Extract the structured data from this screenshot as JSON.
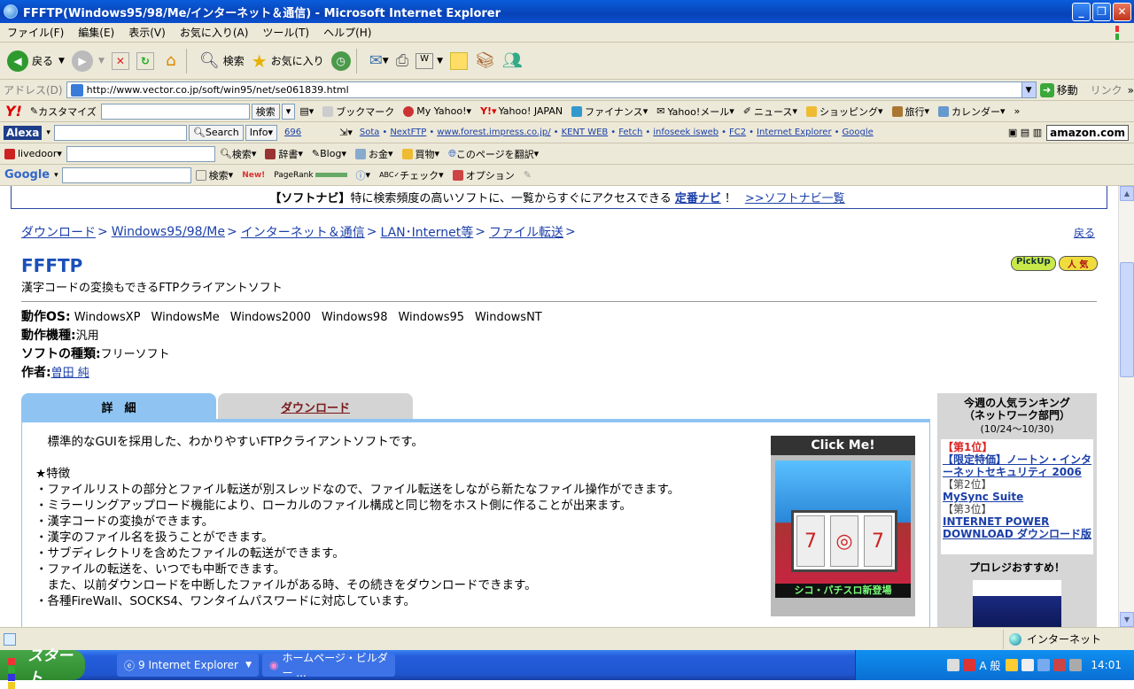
{
  "window": {
    "title": "FFFTP(Windows95/98/Me/インターネット＆通信) - Microsoft Internet Explorer"
  },
  "menu": [
    "ファイル(F)",
    "編集(E)",
    "表示(V)",
    "お気に入り(A)",
    "ツール(T)",
    "ヘルプ(H)"
  ],
  "toolbar": {
    "back": "戻る",
    "search": "検索",
    "favorites": "お気に入り"
  },
  "address": {
    "label": "アドレス(D)",
    "url": "http://www.vector.co.jp/soft/win95/net/se061839.html",
    "go": "移動",
    "links": "リンク"
  },
  "yahoo_bar": {
    "customize": "カスタマイズ",
    "search_btn": "検索",
    "items": [
      "ブックマーク",
      "My Yahoo!",
      "Yahoo! JAPAN",
      "ファイナンス",
      "Yahoo!メール",
      "ニュース",
      "ショッピング",
      "旅行",
      "カレンダー"
    ]
  },
  "alexa_bar": {
    "label": "Alexa",
    "search_btn": "Search",
    "info_btn": "Info",
    "count": "696",
    "links": [
      "Sota",
      "NextFTP",
      "www.forest.impress.co.jp/",
      "KENT WEB",
      "Fetch",
      "infoseek isweb",
      "FC2",
      "Internet Explorer",
      "Google"
    ],
    "amazon": "amazon.com"
  },
  "livedoor_bar": {
    "label": "livedoor",
    "items": [
      "検索",
      "辞書",
      "Blog",
      "お金",
      "買物",
      "このページを翻訳"
    ]
  },
  "google_bar": {
    "label": "Google",
    "search_btn": "検索",
    "new": "New!",
    "pagerank": "PageRank",
    "check": "チェック",
    "options": "オプション"
  },
  "navi": {
    "prefix": "【ソフトナビ】",
    "text": "特に検索頻度の高いソフトに、一覧からすぐにアクセスできる",
    "link1": "定番ナビ",
    "sep": "！",
    "link2": ">>ソフトナビ一覧"
  },
  "breadcrumb": {
    "items": [
      "ダウンロード",
      "Windows95/98/Me",
      "インターネット＆通信",
      "LAN･Internet等",
      "ファイル転送"
    ],
    "gt": ">",
    "back": "戻る"
  },
  "software": {
    "name": "FFFTP",
    "subtitle": "漢字コードの変換もできるFTPクライアントソフト",
    "badge_pickup": "PickUp",
    "badge_popular": "人 気"
  },
  "info": {
    "os_label": "動作OS:",
    "os": [
      "WindowsXP",
      "WindowsMe",
      "Windows2000",
      "Windows98",
      "Windows95",
      "WindowsNT"
    ],
    "machine_label": "動作機種:",
    "machine": "汎用",
    "type_label": "ソフトの種類:",
    "type": "フリーソフト",
    "author_label": "作者:",
    "author": "曽田 純"
  },
  "tabs": {
    "detail": "詳　細",
    "download": "ダウンロード"
  },
  "description": [
    "　標準的なGUIを採用した、わかりやすいFTPクライアントソフトです。",
    "",
    "★特徴",
    "・ファイルリストの部分とファイル転送が別スレッドなので、ファイル転送をしながら新たなファイル操作ができます。",
    "・ミラーリングアップロード機能により、ローカルのファイル構成と同じ物をホスト側に作ることが出来ます。",
    "・漢字コードの変換ができます。",
    "・漢字のファイル名を扱うことができます。",
    "・サブディレクトリを含めたファイルの転送ができます。",
    "・ファイルの転送を、いつでも中断できます。",
    "　また、以前ダウンロードを中断したファイルがある時、その続きをダウンロードできます。",
    "・各種FireWall、SOCKS4、ワンタイムパスワードに対応しています。"
  ],
  "ad": {
    "header": "Click Me!",
    "caption": "シコ・パチスロ新登場"
  },
  "ranking": {
    "title1": "今週の人気ランキング",
    "title2": "（ネットワーク部門）",
    "date": "(10/24〜10/30)",
    "r1_label": "【第1位】",
    "r1": "【限定特価】ノートン・インターネットセキュリティ 2006",
    "r2_label": "【第2位】",
    "r2": "MySync Suite",
    "r3_label": "【第3位】",
    "r3": "INTERNET POWER DOWNLOAD ダウンロード版",
    "prolegis": "プロレジおすすめ！"
  },
  "status": {
    "zone": "インターネット"
  },
  "taskbar": {
    "start": "スタート",
    "task1": "9 Internet Explorer",
    "task2": "ホームページ・ビルダー ...",
    "ime": "A 般",
    "time": "14:01"
  }
}
